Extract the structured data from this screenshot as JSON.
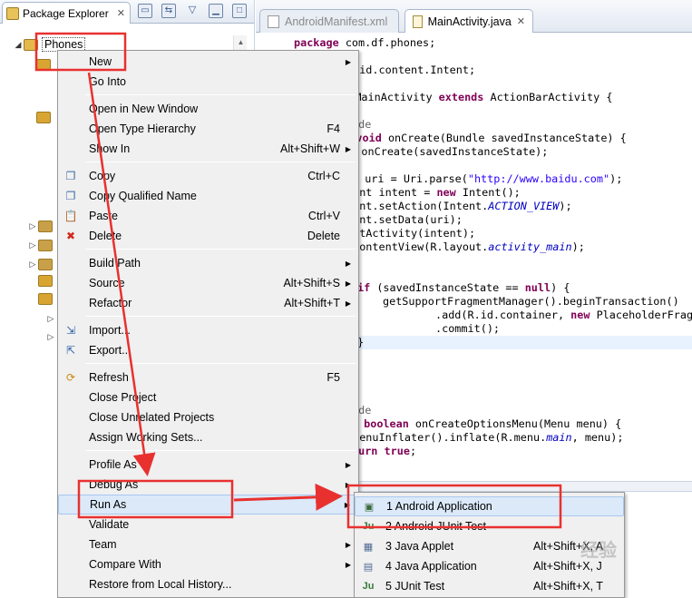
{
  "package_explorer": {
    "tab_label": "Package Explorer",
    "project_name": "Phones"
  },
  "editor": {
    "tabs": [
      {
        "label": "AndroidManifest.xml",
        "active": false
      },
      {
        "label": "MainActivity.java",
        "active": true
      }
    ],
    "code_lines": [
      "package com.df.phones;",
      "roid.content.Intent;",
      "ss MainActivity extends ActionBarActivity {",
      "ide",
      "ted void onCreate(Bundle savedInstanceState) {",
      "per.onCreate(savedInstanceState);",
      "i uri = Uri.parse(\"http://www.baidu.com\");",
      "tent intent = new Intent();",
      "tent.setAction(Intent.ACTION_VIEW);",
      "tent.setData(uri);",
      "artActivity(intent);",
      "tContentView(R.layout.activity_main);",
      "if (savedInstanceState == null) {",
      "getSupportFragmentManager().beginTransaction()",
      ".add(R.id.container, new PlaceholderFragm",
      ".commit();",
      "}",
      "ide",
      " boolean onCreateOptionsMenu(Menu menu) {",
      "tMenuInflater().inflate(R.menu.main, menu);",
      "turn true;"
    ]
  },
  "context_menu": {
    "items": [
      {
        "label": "New",
        "key": "",
        "submenu": true,
        "icon": ""
      },
      {
        "label": "Go Into",
        "key": "",
        "submenu": false,
        "icon": ""
      },
      {
        "sep": true
      },
      {
        "label": "Open in New Window",
        "key": "",
        "submenu": false,
        "icon": ""
      },
      {
        "label": "Open Type Hierarchy",
        "key": "F4",
        "submenu": false,
        "icon": ""
      },
      {
        "label": "Show In",
        "key": "Alt+Shift+W",
        "submenu": true,
        "icon": ""
      },
      {
        "sep": true
      },
      {
        "label": "Copy",
        "key": "Ctrl+C",
        "submenu": false,
        "icon": "copy-icon"
      },
      {
        "label": "Copy Qualified Name",
        "key": "",
        "submenu": false,
        "icon": "copy-icon"
      },
      {
        "label": "Paste",
        "key": "Ctrl+V",
        "submenu": false,
        "icon": "paste-icon"
      },
      {
        "label": "Delete",
        "key": "Delete",
        "submenu": false,
        "icon": "delete-icon"
      },
      {
        "sep": true
      },
      {
        "label": "Build Path",
        "key": "",
        "submenu": true,
        "icon": ""
      },
      {
        "label": "Source",
        "key": "Alt+Shift+S",
        "submenu": true,
        "icon": ""
      },
      {
        "label": "Refactor",
        "key": "Alt+Shift+T",
        "submenu": true,
        "icon": ""
      },
      {
        "sep": true
      },
      {
        "label": "Import...",
        "key": "",
        "submenu": false,
        "icon": "import-icon"
      },
      {
        "label": "Export...",
        "key": "",
        "submenu": false,
        "icon": "export-icon"
      },
      {
        "sep": true
      },
      {
        "label": "Refresh",
        "key": "F5",
        "submenu": false,
        "icon": "refresh-icon"
      },
      {
        "label": "Close Project",
        "key": "",
        "submenu": false,
        "icon": ""
      },
      {
        "label": "Close Unrelated Projects",
        "key": "",
        "submenu": false,
        "icon": ""
      },
      {
        "label": "Assign Working Sets...",
        "key": "",
        "submenu": false,
        "icon": ""
      },
      {
        "sep": true
      },
      {
        "label": "Profile As",
        "key": "",
        "submenu": true,
        "icon": ""
      },
      {
        "label": "Debug As",
        "key": "",
        "submenu": true,
        "icon": ""
      },
      {
        "label": "Run As",
        "key": "",
        "submenu": true,
        "icon": "",
        "selected": true
      },
      {
        "label": "Validate",
        "key": "",
        "submenu": false,
        "icon": ""
      },
      {
        "label": "Team",
        "key": "",
        "submenu": true,
        "icon": ""
      },
      {
        "label": "Compare With",
        "key": "",
        "submenu": true,
        "icon": ""
      },
      {
        "label": "Restore from Local History...",
        "key": "",
        "submenu": false,
        "icon": ""
      }
    ]
  },
  "run_as_submenu": {
    "items": [
      {
        "label": "1 Android Application",
        "key": "",
        "icon": "android-app-icon",
        "selected": true
      },
      {
        "label": "2 Android JUnit Test",
        "key": "",
        "icon": "junit-icon"
      },
      {
        "label": "3 Java Applet",
        "key": "Alt+Shift+X, A",
        "icon": "applet-icon"
      },
      {
        "label": "4 Java Application",
        "key": "Alt+Shift+X, J",
        "icon": "java-app-icon"
      },
      {
        "label": "5 JUnit Test",
        "key": "Alt+Shift+X, T",
        "icon": "junit-icon"
      }
    ]
  },
  "colors": {
    "annotation_red": "#e8312f",
    "menu_bg": "#f0f0f0",
    "menu_selection": "#dbe9f9"
  },
  "watermark": "经验"
}
